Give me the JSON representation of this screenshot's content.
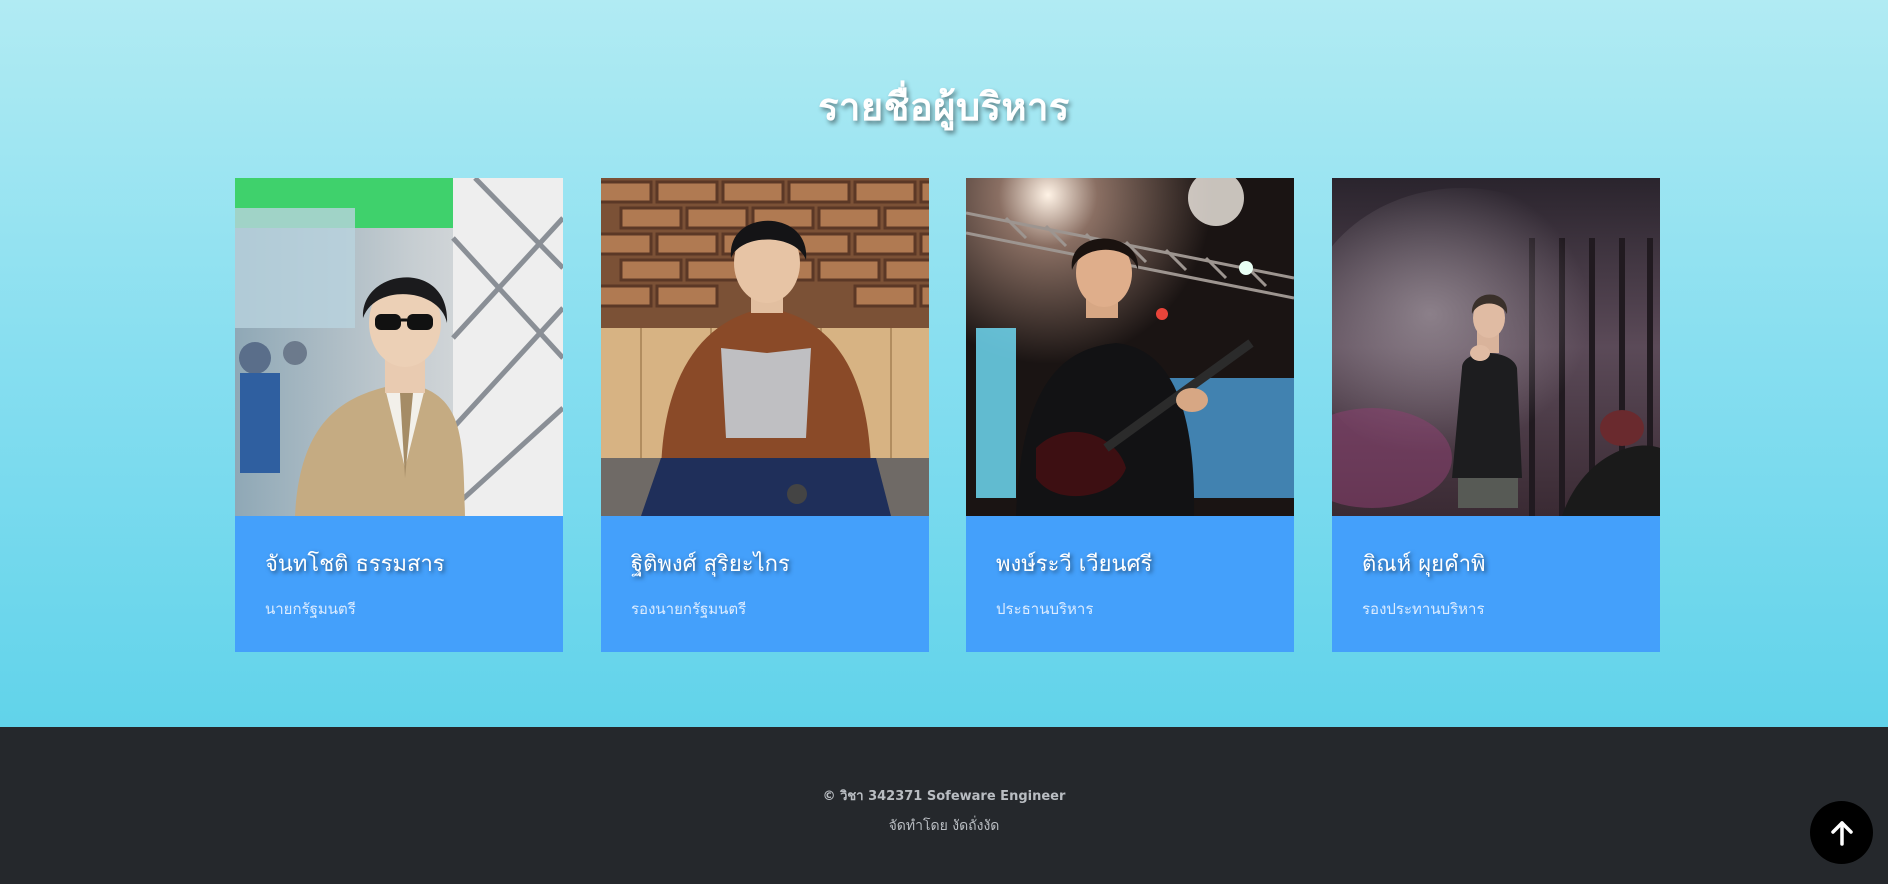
{
  "section": {
    "title": "รายชื่อผู้บริหาร"
  },
  "members": [
    {
      "name": "จันทโชติ ธรรมสาร",
      "role": "นายกรัฐมนตรี"
    },
    {
      "name": "ฐิติพงศ์ สุริยะไกร",
      "role": "รองนายกรัฐมนตรี"
    },
    {
      "name": "พงษ์ระวี เวียนศรี",
      "role": "ประธานบริหาร"
    },
    {
      "name": "ติณห์ ผุยคำพิ",
      "role": "รองประทานบริหาร"
    }
  ],
  "footer": {
    "copyright": "© วิชา 342371 Sofeware Engineer",
    "made_by": "จัดทำโดย งัดถั่งงัด"
  },
  "back_to_top": {
    "icon": "arrow-up-icon"
  },
  "colors": {
    "card_body": "#44a0fb",
    "footer_bg": "#25282c",
    "section_gradient_top": "#b1ebf3",
    "section_gradient_bottom": "#61d3ea"
  }
}
